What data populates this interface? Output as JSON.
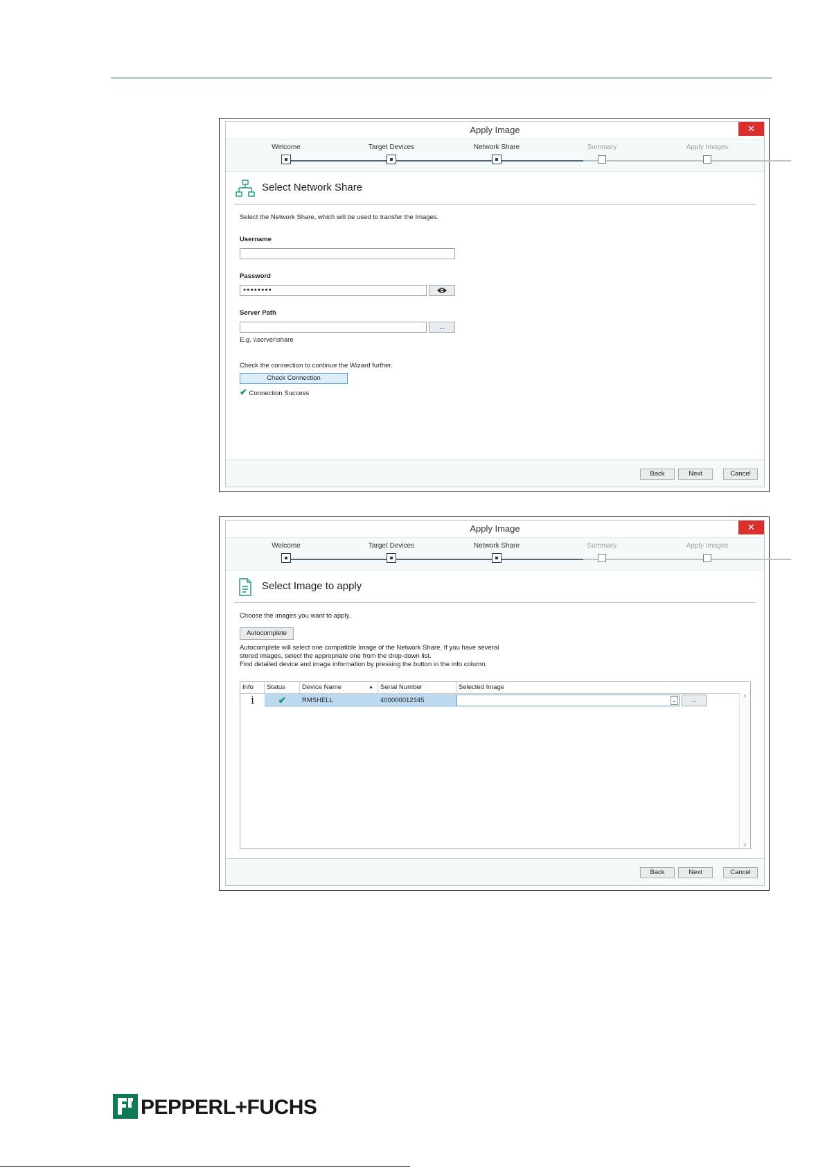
{
  "dialog1": {
    "title": "Apply Image",
    "close": "✕",
    "steps": [
      "Welcome",
      "Target Devices",
      "Network Share",
      "Summary",
      "Apply Images"
    ],
    "heading": "Select Network Share",
    "intro": "Select the Network Share, which will be used to transfer the Images.",
    "username_label": "Username",
    "username_value": "",
    "password_label": "Password",
    "password_value": "●●●●●●●●",
    "server_path_label": "Server Path",
    "server_path_value": "",
    "browse_label": "...",
    "example": "E.g. \\\\server\\share",
    "check_hint": "Check the connection to continue the Wizard further.",
    "check_button": "Check Connection",
    "status": "Connection Success",
    "back": "Back",
    "next": "Next",
    "cancel": "Cancel"
  },
  "dialog2": {
    "title": "Apply Image",
    "close": "✕",
    "steps": [
      "Welcome",
      "Target Devices",
      "Network Share",
      "Summary",
      "Apply Images"
    ],
    "heading": "Select Image to apply",
    "intro": "Choose the images you want to apply.",
    "autocomplete_button": "Autocomplete",
    "help_lines": [
      "Autocomplete will select one compatible Image of the Network Share. If you have several",
      "stored images, select the appropriate one from the drop-down list.",
      "Find detailed device and image information by pressing the button in the info column."
    ],
    "columns": [
      "Info",
      "Status",
      "Device Name",
      "Serial Number",
      "Selected Image"
    ],
    "row": {
      "info": "i",
      "device_name": "RMSHELL",
      "serial_number": "400000012345",
      "selected_image": ""
    },
    "browse_label": "...",
    "back": "Back",
    "next": "Next",
    "cancel": "Cancel"
  },
  "logo_text": "PEPPERL+FUCHS",
  "colors": {
    "accent": "#1a9a7a",
    "close": "#d9302c",
    "selection": "#bcd9ef",
    "stepper_line": "#4f6877"
  }
}
